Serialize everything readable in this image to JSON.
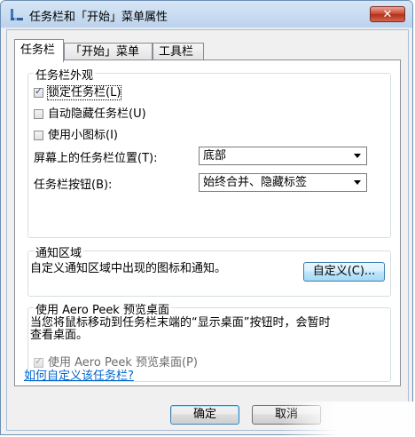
{
  "window": {
    "title": "任务栏和「开始」菜单属性",
    "close_label": "✕"
  },
  "tabs": [
    {
      "label": "任务栏"
    },
    {
      "label": "「开始」菜单"
    },
    {
      "label": "工具栏"
    }
  ],
  "appearance": {
    "group_label": "任务栏外观",
    "lock_taskbar": {
      "label": "锁定任务栏(L)",
      "checked": true
    },
    "auto_hide": {
      "label": "自动隐藏任务栏(U)",
      "checked": false
    },
    "small_icons": {
      "label": "使用小图标(I)",
      "checked": false
    },
    "location_label": "屏幕上的任务栏位置(T):",
    "location_value": "底部",
    "buttons_label": "任务栏按钮(B):",
    "buttons_value": "始终合并、隐藏标签"
  },
  "notification": {
    "group_label": "通知区域",
    "description": "自定义通知区域中出现的图标和通知。",
    "customize_label": "自定义(C)..."
  },
  "aero_peek": {
    "group_label": "使用 Aero Peek 预览桌面",
    "description_line1": "当您将鼠标移动到任务栏末端的“显示桌面”按钮时，会暂时",
    "description_line2": "查看桌面。",
    "checkbox_label": "使用 Aero Peek 预览桌面(P)",
    "checked": true
  },
  "help_link": "如何自定义该任务栏?",
  "footer": {
    "ok_label": "确定",
    "cancel_label": "取消"
  },
  "colors": {
    "accent": "#3c7fb1",
    "link": "#0066cc",
    "close": "#c7422a"
  }
}
